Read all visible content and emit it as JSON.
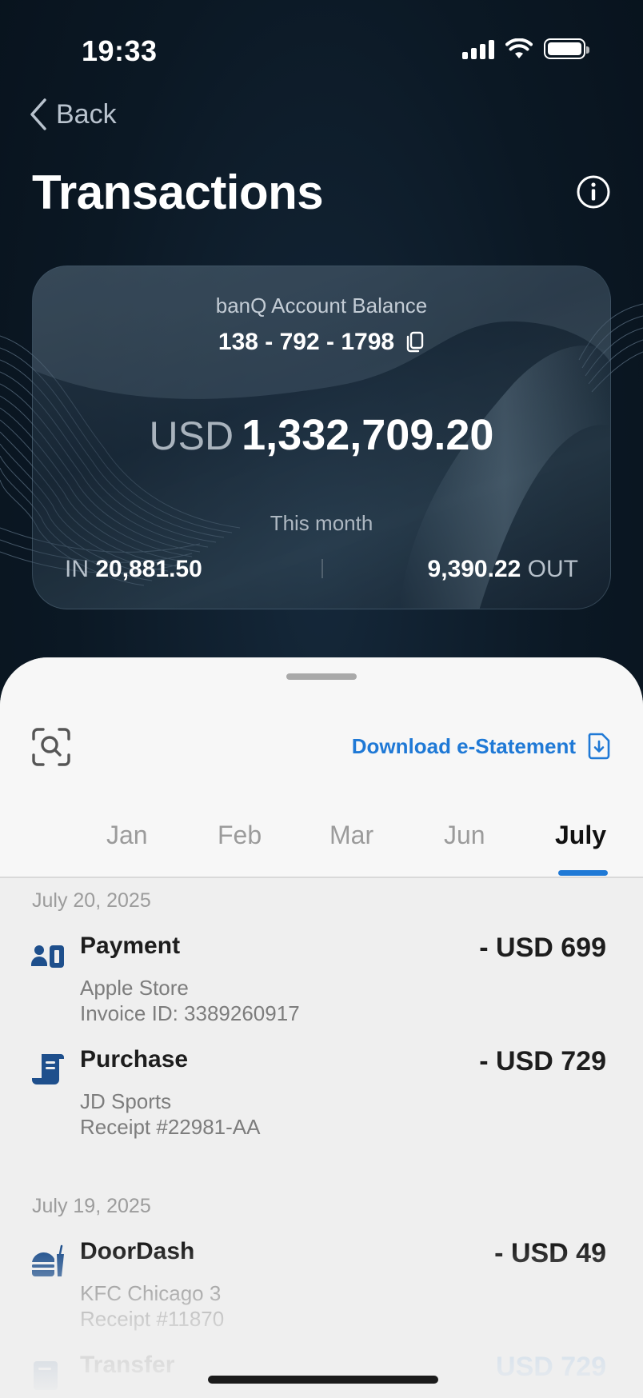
{
  "status_bar": {
    "time": "19:33"
  },
  "header": {
    "back_label": "Back",
    "title": "Transactions"
  },
  "account_card": {
    "title": "banQ Account Balance",
    "account_number": "138 - 792 - 1798",
    "currency": "USD",
    "balance": "1,332,709.20",
    "period_label": "This month",
    "in_label": "IN",
    "in_amount": "20,881.50",
    "out_amount": "9,390.22",
    "out_label": "OUT"
  },
  "sheet": {
    "download_label": "Download e-Statement",
    "tabs": [
      {
        "label": "Jan",
        "active": false
      },
      {
        "label": "Feb",
        "active": false
      },
      {
        "label": "Mar",
        "active": false
      },
      {
        "label": "Jun",
        "active": false
      },
      {
        "label": "July",
        "active": true
      }
    ]
  },
  "groups": [
    {
      "date": "July 20, 2025",
      "transactions": [
        {
          "icon": "payment-icon",
          "name": "Payment",
          "line1": "Apple Store",
          "line2": "Invoice ID: 3389260917",
          "amount": "- USD 699"
        },
        {
          "icon": "receipt-icon",
          "name": "Purchase",
          "line1": "JD Sports",
          "line2": "Receipt #22981-AA",
          "amount": "- USD 729"
        }
      ]
    },
    {
      "date": "July 19, 2025",
      "transactions": [
        {
          "icon": "food-icon",
          "name": "DoorDash",
          "line1": "KFC Chicago 3",
          "line2": "Receipt #11870",
          "amount": "- USD 49"
        },
        {
          "icon": "transfer-icon",
          "name": "Transfer",
          "line1": "",
          "line2": "",
          "amount": "USD 729"
        }
      ]
    }
  ],
  "colors": {
    "accent": "#1f79d6",
    "background": "#0b1824",
    "sheet": "#efefef"
  }
}
